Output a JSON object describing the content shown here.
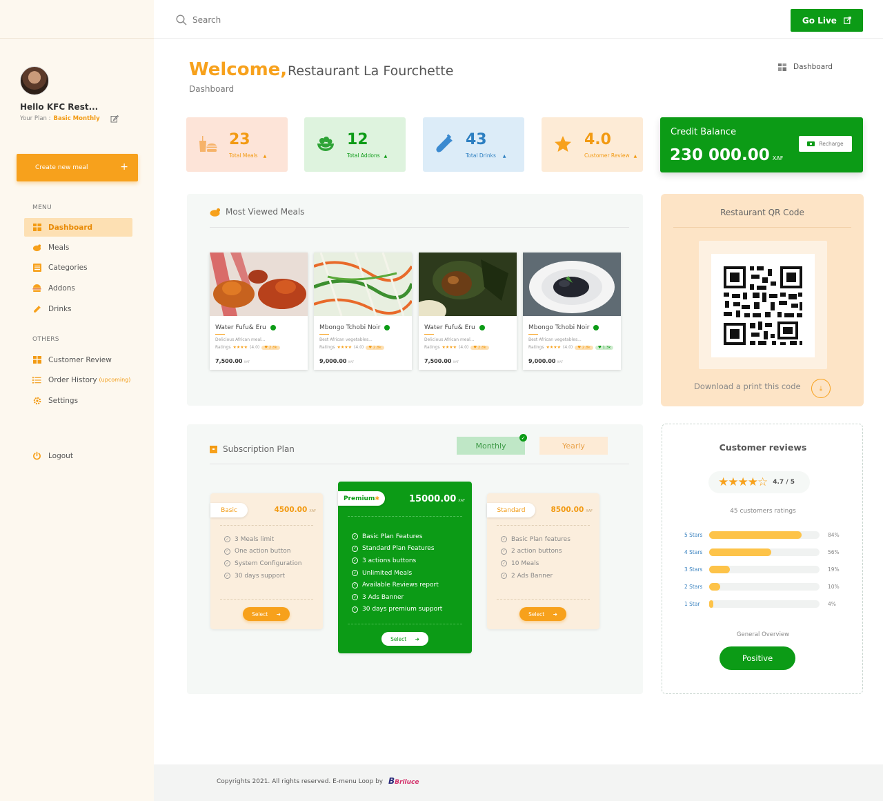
{
  "sidebar": {
    "greeting": "Hello KFC Rest...",
    "plan_label": "Your Plan :",
    "plan_name": "Basic Monthly",
    "create_meal_label": "Create new meal",
    "menu_label": "MENU",
    "menu_items": [
      {
        "label": "Dashboard",
        "icon": "dashboard-icon"
      },
      {
        "label": "Meals",
        "icon": "chicken-icon"
      },
      {
        "label": "Categories",
        "icon": "list-icon"
      },
      {
        "label": "Addons",
        "icon": "burger-icon"
      },
      {
        "label": "Drinks",
        "icon": "bottle-icon"
      }
    ],
    "others_label": "OTHERS",
    "other_items": [
      {
        "label": "Customer Review",
        "icon": "grid-icon"
      },
      {
        "label": "Order History",
        "badge": "(upcoming)",
        "icon": "list-icon"
      },
      {
        "label": "Settings",
        "icon": "gear-icon"
      }
    ],
    "logout_label": "Logout"
  },
  "header": {
    "search_placeholder": "Search",
    "go_live_label": "Go Live"
  },
  "main": {
    "welcome": "Welcome,",
    "restaurant_name": "Restaurant La Fourchette",
    "subtitle": "Dashboard",
    "breadcrumb": "Dashboard",
    "stats": [
      {
        "value": "23",
        "label": "Total Meals",
        "bg": "#fde4d8",
        "color": "#f29a12"
      },
      {
        "value": "12",
        "label": "Total Addons",
        "bg": "#def3de",
        "color": "#0c9b16"
      },
      {
        "value": "43",
        "label": "Total Drinks",
        "bg": "#dcecf8",
        "color": "#2d7fc1"
      },
      {
        "value": "4.0",
        "label": "Customer Review",
        "bg": "#fdebd6",
        "color": "#f29a12"
      }
    ],
    "credit": {
      "title": "Credit Balance",
      "amount": "230 000.00",
      "currency": "XAF",
      "recharge_label": "Recharge"
    }
  },
  "most_viewed": {
    "title": "Most Viewed Meals",
    "meals": [
      {
        "name": "Water Fufu& Eru",
        "desc": "Delicious African meal...",
        "ratings_label": "Ratings",
        "rating": "(4.0)",
        "pill": "2.8k",
        "price": "7,500.00",
        "currency": "XAF"
      },
      {
        "name": "Mbongo Tchobi Noir",
        "desc": "Best African vegetables...",
        "ratings_label": "Ratings",
        "rating": "(4.0)",
        "pill": "2.8k",
        "price": "9,000.00",
        "currency": "XAF"
      },
      {
        "name": "Water Fufu& Eru",
        "desc": "Delicious African meal...",
        "ratings_label": "Ratings",
        "rating": "(4.0)",
        "pill": "2.8k",
        "price": "7,500.00",
        "currency": "XAF"
      },
      {
        "name": "Mbongo Tchobi Noir",
        "desc": "Best African vegetables...",
        "ratings_label": "Ratings",
        "rating": "(4.0)",
        "pill": "2.8k",
        "pill2": "1.3k",
        "price": "9,000.00",
        "currency": "XAF"
      }
    ]
  },
  "qr": {
    "title": "Restaurant QR Code",
    "download_text": "Download a print this code"
  },
  "subscription": {
    "title": "Subscription Plan",
    "monthly_label": "Monthly",
    "yearly_label": "Yearly",
    "plans": [
      {
        "name": "Basic",
        "price": "4500.00",
        "currency": "XAF",
        "features": [
          "3 Meals limit",
          "One action button",
          "System Configuration",
          "30 days support"
        ],
        "select_label": "Select"
      },
      {
        "name": "Premium",
        "price": "15000.00",
        "currency": "XAF",
        "features": [
          "Basic Plan Features",
          "Standard Plan Features",
          "3 actions buttons",
          "Unlimited Meals",
          "Available Reviews report",
          "3 Ads Banner",
          "30 days premium support"
        ],
        "select_label": "Select"
      },
      {
        "name": "Standard",
        "price": "8500.00",
        "currency": "XAF",
        "features": [
          "Basic Plan features",
          "2 action buttons",
          "10 Meals",
          "2 Ads Banner"
        ],
        "select_label": "Select"
      }
    ]
  },
  "reviews": {
    "title": "Customer reviews",
    "score": "4.7 / 5",
    "rating_value": 4.7,
    "count": "45 customers ratings",
    "rows": [
      {
        "label": "5 Stars",
        "pct": "84%",
        "value": 84
      },
      {
        "label": "4 Stars",
        "pct": "56%",
        "value": 56
      },
      {
        "label": "3 Stars",
        "pct": "19%",
        "value": 19
      },
      {
        "label": "2 Stars",
        "pct": "10%",
        "value": 10
      },
      {
        "label": "1 Star",
        "pct": "4%",
        "value": 4
      }
    ],
    "overview_label": "General Overview",
    "overview_value": "Positive"
  },
  "footer": {
    "text": "Copyrights 2021. All rights reserved. E-menu Loop by",
    "logo": "Briluce"
  }
}
